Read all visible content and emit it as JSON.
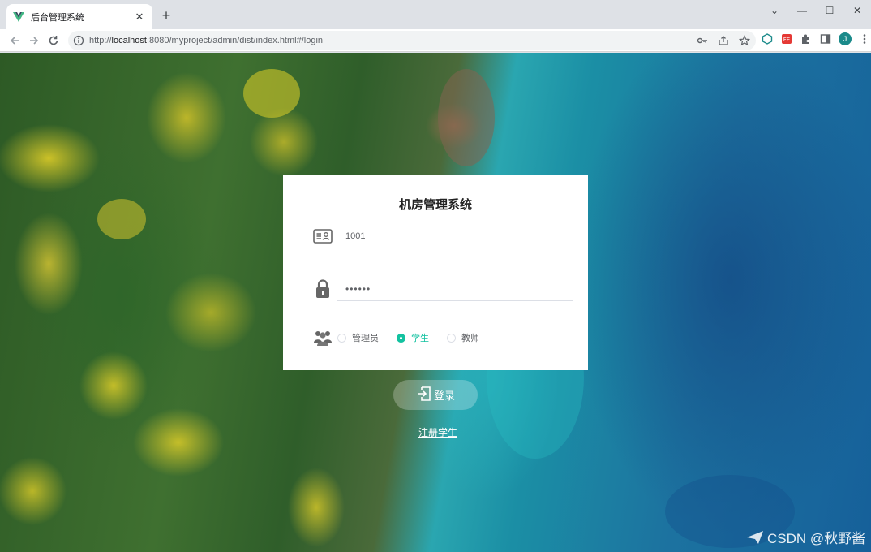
{
  "browser": {
    "tab_title": "后台管理系统",
    "tab_close": "✕",
    "new_tab": "+",
    "url_prefix": "http://",
    "url_host": "localhost",
    "url_rest": ":8080/myproject/admin/dist/index.html#/login",
    "profile_initial": "J",
    "window_controls": [
      "⌄",
      "—",
      "☐",
      "✕"
    ]
  },
  "login": {
    "title": "机房管理系统",
    "username_value": "1001",
    "password_value": "••••••",
    "roles": [
      {
        "label": "管理员",
        "checked": false
      },
      {
        "label": "学生",
        "checked": true
      },
      {
        "label": "教师",
        "checked": false
      }
    ],
    "submit_label": "登录",
    "register_label": "注册学生"
  },
  "watermark": "CSDN @秋野酱",
  "colors": {
    "accent": "#13c2a0"
  }
}
